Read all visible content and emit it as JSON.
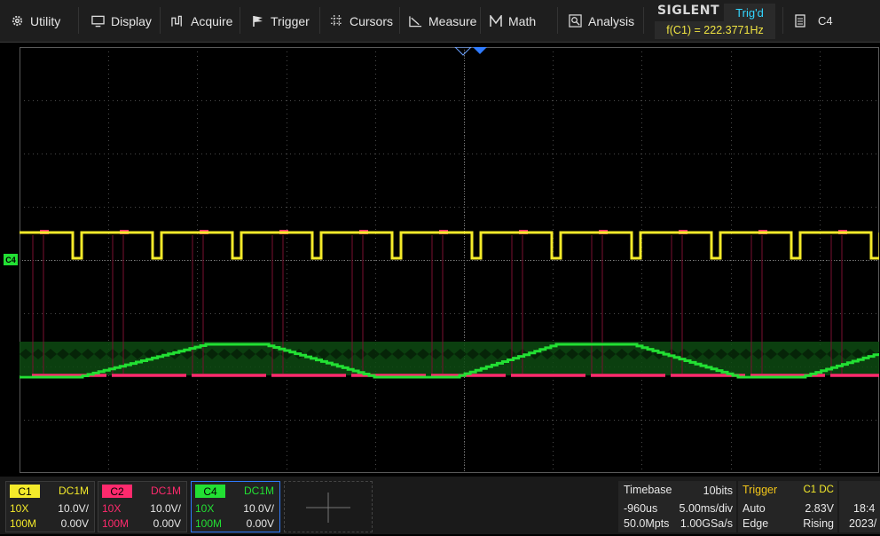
{
  "menu": {
    "utility": "Utility",
    "display": "Display",
    "acquire": "Acquire",
    "trigger": "Trigger",
    "cursors": "Cursors",
    "measure": "Measure",
    "math": "Math",
    "analysis": "Analysis"
  },
  "brand": "SIGLENT",
  "trig_status": "Trig'd",
  "freq_readout": "f(C1) = 222.3771Hz",
  "channel_selector": "C4",
  "c4_marker": "C4",
  "channels": [
    {
      "name": "C1",
      "coupling": "DC1M",
      "probe": "10X",
      "scale": "10.0V/",
      "bw": "100M",
      "offset": "0.00V",
      "color": "#f4ea2a"
    },
    {
      "name": "C2",
      "coupling": "DC1M",
      "probe": "10X",
      "scale": "10.0V/",
      "bw": "100M",
      "offset": "0.00V",
      "color": "#ff2a6d"
    },
    {
      "name": "C4",
      "coupling": "DC1M",
      "probe": "10X",
      "scale": "10.0V/",
      "bw": "100M",
      "offset": "0.00V",
      "color": "#22e033"
    }
  ],
  "timebase": {
    "title": "Timebase",
    "bits": "10bits",
    "delay": "-960us",
    "scale": "5.00ms/div",
    "memory": "50.0Mpts",
    "sample_rate": "1.00GSa/s"
  },
  "trigger": {
    "title": "Trigger",
    "source": "C1 DC",
    "mode": "Auto",
    "level": "2.83V",
    "type": "Edge",
    "slope": "Rising"
  },
  "clock": {
    "time": "18:4",
    "date": "2023/"
  },
  "colors": {
    "background": "#000000",
    "grid": "#4a4a4a",
    "c1": "#f4ea2a",
    "c2": "#ff2a6d",
    "c4": "#22e033",
    "trigger_status": "#33d6ff",
    "trigger_title": "#f0c419"
  }
}
